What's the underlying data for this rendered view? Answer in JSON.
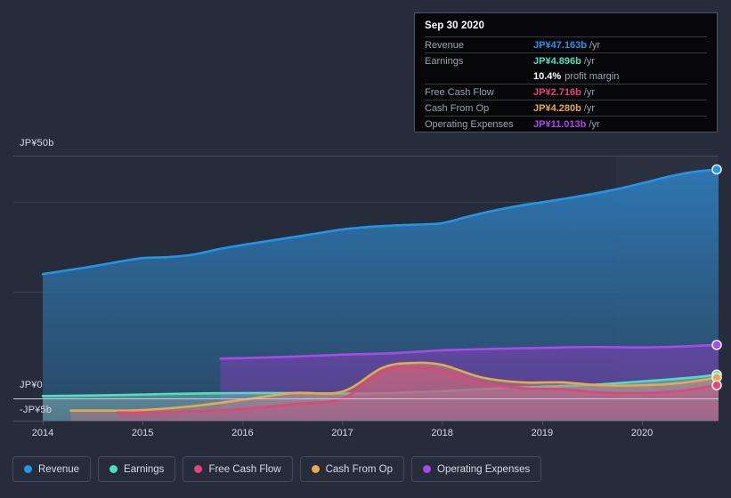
{
  "chart_data": {
    "type": "line",
    "title": "",
    "xlabel": "",
    "ylabel": "",
    "currency": "JP¥",
    "x_tick_labels": [
      "2014",
      "2015",
      "2016",
      "2017",
      "2018",
      "2019",
      "2020"
    ],
    "y_tick_labels": [
      "JP¥50b",
      "JP¥0",
      "-JP¥5b"
    ],
    "ylim": [
      -5,
      50
    ],
    "grid": true,
    "legend_position": "bottom",
    "series": [
      {
        "name": "Revenue",
        "color": "#2196e8",
        "values": [
          {
            "x": 2014.0,
            "y": 25.6
          },
          {
            "x": 2014.25,
            "y": 26.4
          },
          {
            "x": 2014.5,
            "y": 27.2
          },
          {
            "x": 2014.75,
            "y": 28.1
          },
          {
            "x": 2015.0,
            "y": 28.9
          },
          {
            "x": 2015.25,
            "y": 29.1
          },
          {
            "x": 2015.5,
            "y": 29.6
          },
          {
            "x": 2015.75,
            "y": 30.7
          },
          {
            "x": 2016.0,
            "y": 31.6
          },
          {
            "x": 2016.25,
            "y": 32.4
          },
          {
            "x": 2016.5,
            "y": 33.2
          },
          {
            "x": 2016.75,
            "y": 34.0
          },
          {
            "x": 2017.0,
            "y": 34.8
          },
          {
            "x": 2017.25,
            "y": 35.3
          },
          {
            "x": 2017.5,
            "y": 35.6
          },
          {
            "x": 2017.75,
            "y": 35.8
          },
          {
            "x": 2018.0,
            "y": 36.1
          },
          {
            "x": 2018.25,
            "y": 37.4
          },
          {
            "x": 2018.5,
            "y": 38.6
          },
          {
            "x": 2018.75,
            "y": 39.6
          },
          {
            "x": 2019.0,
            "y": 40.4
          },
          {
            "x": 2019.25,
            "y": 41.2
          },
          {
            "x": 2019.5,
            "y": 42.1
          },
          {
            "x": 2019.75,
            "y": 43.1
          },
          {
            "x": 2020.0,
            "y": 44.3
          },
          {
            "x": 2020.25,
            "y": 45.6
          },
          {
            "x": 2020.5,
            "y": 46.6
          },
          {
            "x": 2020.75,
            "y": 47.163
          }
        ]
      },
      {
        "name": "Earnings",
        "color": "#4ee0bd",
        "values": [
          {
            "x": 2014.0,
            "y": 0.5
          },
          {
            "x": 2014.5,
            "y": 0.6
          },
          {
            "x": 2015.0,
            "y": 0.8
          },
          {
            "x": 2015.5,
            "y": 1.0
          },
          {
            "x": 2016.0,
            "y": 1.1
          },
          {
            "x": 2016.5,
            "y": 1.1
          },
          {
            "x": 2017.0,
            "y": 1.0
          },
          {
            "x": 2017.5,
            "y": 1.1
          },
          {
            "x": 2018.0,
            "y": 1.5
          },
          {
            "x": 2018.5,
            "y": 2.0
          },
          {
            "x": 2019.0,
            "y": 2.4
          },
          {
            "x": 2019.5,
            "y": 2.8
          },
          {
            "x": 2020.0,
            "y": 3.5
          },
          {
            "x": 2020.5,
            "y": 4.3
          },
          {
            "x": 2020.75,
            "y": 4.896
          }
        ]
      },
      {
        "name": "Free Cash Flow",
        "color": "#e0457b",
        "values": [
          {
            "x": 2014.75,
            "y": -2.9
          },
          {
            "x": 2015.0,
            "y": -2.9
          },
          {
            "x": 2015.5,
            "y": -2.7
          },
          {
            "x": 2016.0,
            "y": -2.2
          },
          {
            "x": 2016.5,
            "y": -1.2
          },
          {
            "x": 2017.0,
            "y": 0.0
          },
          {
            "x": 2017.4,
            "y": 5.5
          },
          {
            "x": 2017.7,
            "y": 6.3
          },
          {
            "x": 2018.0,
            "y": 5.6
          },
          {
            "x": 2018.4,
            "y": 3.1
          },
          {
            "x": 2018.8,
            "y": 2.1
          },
          {
            "x": 2019.2,
            "y": 1.9
          },
          {
            "x": 2019.6,
            "y": 1.2
          },
          {
            "x": 2020.0,
            "y": 1.1
          },
          {
            "x": 2020.4,
            "y": 1.6
          },
          {
            "x": 2020.75,
            "y": 2.716
          }
        ]
      },
      {
        "name": "Cash From Op",
        "color": "#e8a84c",
        "values": [
          {
            "x": 2014.28,
            "y": -2.5
          },
          {
            "x": 2014.75,
            "y": -2.5
          },
          {
            "x": 2015.0,
            "y": -2.4
          },
          {
            "x": 2015.5,
            "y": -1.6
          },
          {
            "x": 2016.0,
            "y": -0.3
          },
          {
            "x": 2016.5,
            "y": 1.1
          },
          {
            "x": 2017.0,
            "y": 1.4
          },
          {
            "x": 2017.4,
            "y": 6.3
          },
          {
            "x": 2017.7,
            "y": 7.3
          },
          {
            "x": 2018.0,
            "y": 6.9
          },
          {
            "x": 2018.4,
            "y": 4.3
          },
          {
            "x": 2018.8,
            "y": 3.3
          },
          {
            "x": 2019.2,
            "y": 3.3
          },
          {
            "x": 2019.6,
            "y": 2.7
          },
          {
            "x": 2020.0,
            "y": 2.7
          },
          {
            "x": 2020.4,
            "y": 3.2
          },
          {
            "x": 2020.75,
            "y": 4.28
          }
        ]
      },
      {
        "name": "Operating Expenses",
        "color": "#a74ae8",
        "values": [
          {
            "x": 2015.78,
            "y": 8.2
          },
          {
            "x": 2016.0,
            "y": 8.3
          },
          {
            "x": 2016.5,
            "y": 8.6
          },
          {
            "x": 2017.0,
            "y": 9.0
          },
          {
            "x": 2017.5,
            "y": 9.3
          },
          {
            "x": 2018.0,
            "y": 9.9
          },
          {
            "x": 2018.5,
            "y": 10.2
          },
          {
            "x": 2019.0,
            "y": 10.4
          },
          {
            "x": 2019.5,
            "y": 10.6
          },
          {
            "x": 2020.0,
            "y": 10.5
          },
          {
            "x": 2020.4,
            "y": 10.7
          },
          {
            "x": 2020.75,
            "y": 11.013
          }
        ]
      }
    ]
  },
  "tooltip": {
    "date": "Sep 30 2020",
    "rows": [
      {
        "label": "Revenue",
        "value": "JP¥47.163b",
        "unit": "/yr",
        "color": "#2196e8"
      },
      {
        "label": "Earnings",
        "value": "JP¥4.896b",
        "unit": "/yr",
        "color": "#4ee0bd"
      },
      {
        "label": "",
        "value": "10.4%",
        "unit": "profit margin",
        "color": "#ffffff",
        "margin_row": true
      },
      {
        "label": "Free Cash Flow",
        "value": "JP¥2.716b",
        "unit": "/yr",
        "color": "#e0457b"
      },
      {
        "label": "Cash From Op",
        "value": "JP¥4.280b",
        "unit": "/yr",
        "color": "#e8a84c"
      },
      {
        "label": "Operating Expenses",
        "value": "JP¥11.013b",
        "unit": "/yr",
        "color": "#a74ae8"
      }
    ]
  },
  "legend": {
    "items": [
      {
        "label": "Revenue",
        "color": "#2196e8"
      },
      {
        "label": "Earnings",
        "color": "#4ee0bd"
      },
      {
        "label": "Free Cash Flow",
        "color": "#e0457b"
      },
      {
        "label": "Cash From Op",
        "color": "#e8a84c"
      },
      {
        "label": "Operating Expenses",
        "color": "#a74ae8"
      }
    ]
  },
  "axes": {
    "y_top": "JP¥50b",
    "y_zero": "JP¥0",
    "y_neg": "-JP¥5b",
    "x_ticks": [
      "2014",
      "2015",
      "2016",
      "2017",
      "2018",
      "2019",
      "2020"
    ]
  }
}
